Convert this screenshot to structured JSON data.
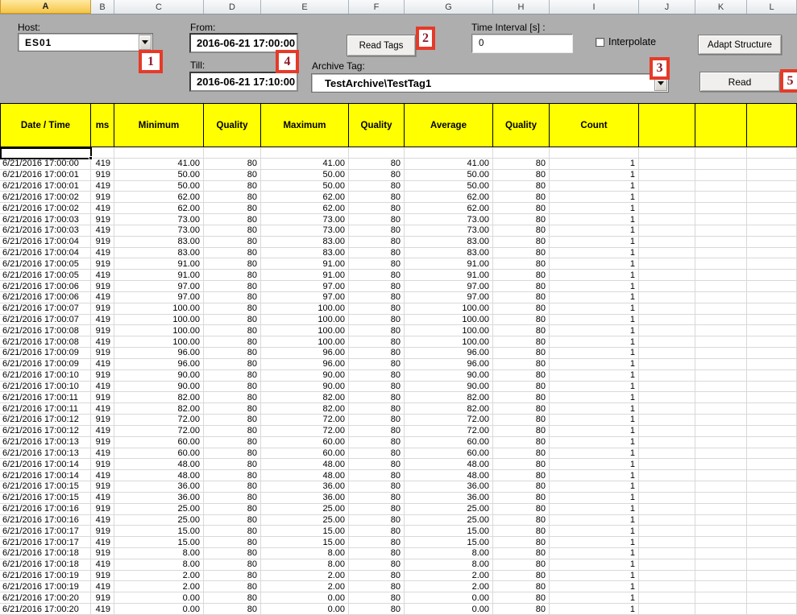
{
  "colors": {
    "table_header_fill": "#ffff00",
    "panel_gray": "#aeaeae",
    "callout_red": "#e63a28",
    "selected_column_fill": "#f6c545",
    "gridline": "#d9d9d9"
  },
  "column_strip": {
    "letters": [
      "A",
      "B",
      "C",
      "D",
      "E",
      "F",
      "G",
      "H",
      "I",
      "J",
      "K",
      "L"
    ],
    "selected": "A"
  },
  "form": {
    "host": {
      "label": "Host:",
      "value": "ES01"
    },
    "from": {
      "label": "From:",
      "value": "2016-06-21 17:00:00"
    },
    "till": {
      "label": "Till:",
      "value": "2016-06-21 17:10:00"
    },
    "read_tags_label": "Read Tags",
    "time_interval": {
      "label": "Time Interval [s] :",
      "value": "0"
    },
    "interpolate_label": "Interpolate",
    "archive_tag": {
      "label": "Archive Tag:",
      "value": "TestArchive\\TestTag1"
    },
    "adapt_structure_label": "Adapt Structure",
    "read_label": "Read"
  },
  "callouts": [
    "1",
    "2",
    "3",
    "4",
    "5"
  ],
  "table": {
    "headers": [
      "Date / Time",
      "ms",
      "Minimum",
      "Quality",
      "Maximum",
      "Quality",
      "Average",
      "Quality",
      "Count",
      "",
      "",
      ""
    ],
    "rows": [
      [
        "6/21/2016 17:00:00",
        "419",
        "41.00",
        "80",
        "41.00",
        "80",
        "41.00",
        "80",
        "1"
      ],
      [
        "6/21/2016 17:00:01",
        "919",
        "50.00",
        "80",
        "50.00",
        "80",
        "50.00",
        "80",
        "1"
      ],
      [
        "6/21/2016 17:00:01",
        "419",
        "50.00",
        "80",
        "50.00",
        "80",
        "50.00",
        "80",
        "1"
      ],
      [
        "6/21/2016 17:00:02",
        "919",
        "62.00",
        "80",
        "62.00",
        "80",
        "62.00",
        "80",
        "1"
      ],
      [
        "6/21/2016 17:00:02",
        "419",
        "62.00",
        "80",
        "62.00",
        "80",
        "62.00",
        "80",
        "1"
      ],
      [
        "6/21/2016 17:00:03",
        "919",
        "73.00",
        "80",
        "73.00",
        "80",
        "73.00",
        "80",
        "1"
      ],
      [
        "6/21/2016 17:00:03",
        "419",
        "73.00",
        "80",
        "73.00",
        "80",
        "73.00",
        "80",
        "1"
      ],
      [
        "6/21/2016 17:00:04",
        "919",
        "83.00",
        "80",
        "83.00",
        "80",
        "83.00",
        "80",
        "1"
      ],
      [
        "6/21/2016 17:00:04",
        "419",
        "83.00",
        "80",
        "83.00",
        "80",
        "83.00",
        "80",
        "1"
      ],
      [
        "6/21/2016 17:00:05",
        "919",
        "91.00",
        "80",
        "91.00",
        "80",
        "91.00",
        "80",
        "1"
      ],
      [
        "6/21/2016 17:00:05",
        "419",
        "91.00",
        "80",
        "91.00",
        "80",
        "91.00",
        "80",
        "1"
      ],
      [
        "6/21/2016 17:00:06",
        "919",
        "97.00",
        "80",
        "97.00",
        "80",
        "97.00",
        "80",
        "1"
      ],
      [
        "6/21/2016 17:00:06",
        "419",
        "97.00",
        "80",
        "97.00",
        "80",
        "97.00",
        "80",
        "1"
      ],
      [
        "6/21/2016 17:00:07",
        "919",
        "100.00",
        "80",
        "100.00",
        "80",
        "100.00",
        "80",
        "1"
      ],
      [
        "6/21/2016 17:00:07",
        "419",
        "100.00",
        "80",
        "100.00",
        "80",
        "100.00",
        "80",
        "1"
      ],
      [
        "6/21/2016 17:00:08",
        "919",
        "100.00",
        "80",
        "100.00",
        "80",
        "100.00",
        "80",
        "1"
      ],
      [
        "6/21/2016 17:00:08",
        "419",
        "100.00",
        "80",
        "100.00",
        "80",
        "100.00",
        "80",
        "1"
      ],
      [
        "6/21/2016 17:00:09",
        "919",
        "96.00",
        "80",
        "96.00",
        "80",
        "96.00",
        "80",
        "1"
      ],
      [
        "6/21/2016 17:00:09",
        "419",
        "96.00",
        "80",
        "96.00",
        "80",
        "96.00",
        "80",
        "1"
      ],
      [
        "6/21/2016 17:00:10",
        "919",
        "90.00",
        "80",
        "90.00",
        "80",
        "90.00",
        "80",
        "1"
      ],
      [
        "6/21/2016 17:00:10",
        "419",
        "90.00",
        "80",
        "90.00",
        "80",
        "90.00",
        "80",
        "1"
      ],
      [
        "6/21/2016 17:00:11",
        "919",
        "82.00",
        "80",
        "82.00",
        "80",
        "82.00",
        "80",
        "1"
      ],
      [
        "6/21/2016 17:00:11",
        "419",
        "82.00",
        "80",
        "82.00",
        "80",
        "82.00",
        "80",
        "1"
      ],
      [
        "6/21/2016 17:00:12",
        "919",
        "72.00",
        "80",
        "72.00",
        "80",
        "72.00",
        "80",
        "1"
      ],
      [
        "6/21/2016 17:00:12",
        "419",
        "72.00",
        "80",
        "72.00",
        "80",
        "72.00",
        "80",
        "1"
      ],
      [
        "6/21/2016 17:00:13",
        "919",
        "60.00",
        "80",
        "60.00",
        "80",
        "60.00",
        "80",
        "1"
      ],
      [
        "6/21/2016 17:00:13",
        "419",
        "60.00",
        "80",
        "60.00",
        "80",
        "60.00",
        "80",
        "1"
      ],
      [
        "6/21/2016 17:00:14",
        "919",
        "48.00",
        "80",
        "48.00",
        "80",
        "48.00",
        "80",
        "1"
      ],
      [
        "6/21/2016 17:00:14",
        "419",
        "48.00",
        "80",
        "48.00",
        "80",
        "48.00",
        "80",
        "1"
      ],
      [
        "6/21/2016 17:00:15",
        "919",
        "36.00",
        "80",
        "36.00",
        "80",
        "36.00",
        "80",
        "1"
      ],
      [
        "6/21/2016 17:00:15",
        "419",
        "36.00",
        "80",
        "36.00",
        "80",
        "36.00",
        "80",
        "1"
      ],
      [
        "6/21/2016 17:00:16",
        "919",
        "25.00",
        "80",
        "25.00",
        "80",
        "25.00",
        "80",
        "1"
      ],
      [
        "6/21/2016 17:00:16",
        "419",
        "25.00",
        "80",
        "25.00",
        "80",
        "25.00",
        "80",
        "1"
      ],
      [
        "6/21/2016 17:00:17",
        "919",
        "15.00",
        "80",
        "15.00",
        "80",
        "15.00",
        "80",
        "1"
      ],
      [
        "6/21/2016 17:00:17",
        "419",
        "15.00",
        "80",
        "15.00",
        "80",
        "15.00",
        "80",
        "1"
      ],
      [
        "6/21/2016 17:00:18",
        "919",
        "8.00",
        "80",
        "8.00",
        "80",
        "8.00",
        "80",
        "1"
      ],
      [
        "6/21/2016 17:00:18",
        "419",
        "8.00",
        "80",
        "8.00",
        "80",
        "8.00",
        "80",
        "1"
      ],
      [
        "6/21/2016 17:00:19",
        "919",
        "2.00",
        "80",
        "2.00",
        "80",
        "2.00",
        "80",
        "1"
      ],
      [
        "6/21/2016 17:00:19",
        "419",
        "2.00",
        "80",
        "2.00",
        "80",
        "2.00",
        "80",
        "1"
      ],
      [
        "6/21/2016 17:00:20",
        "919",
        "0.00",
        "80",
        "0.00",
        "80",
        "0.00",
        "80",
        "1"
      ],
      [
        "6/21/2016 17:00:20",
        "419",
        "0.00",
        "80",
        "0.00",
        "80",
        "0.00",
        "80",
        "1"
      ]
    ]
  }
}
